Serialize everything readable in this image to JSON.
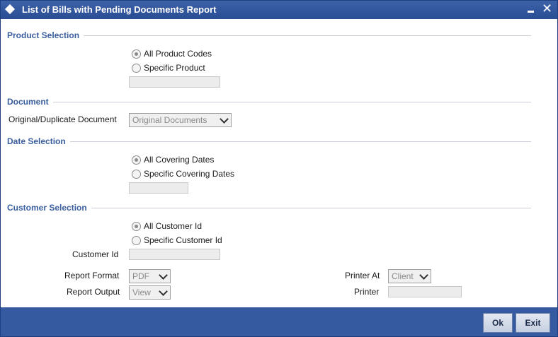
{
  "window": {
    "title": "List of Bills with Pending Documents Report",
    "minimize_symbol": "",
    "close_symbol": "✕"
  },
  "product_selection": {
    "heading": "Product Selection",
    "options": [
      "All Product Codes",
      "Specific Product"
    ],
    "selected_index": 0,
    "product_field_value": ""
  },
  "document": {
    "heading": "Document",
    "label": "Original/Duplicate Document",
    "selected": "Original Documents"
  },
  "date_selection": {
    "heading": "Date Selection",
    "options": [
      "All Covering Dates",
      "Specific Covering Dates"
    ],
    "selected_index": 0,
    "date_field_value": ""
  },
  "customer_selection": {
    "heading": "Customer Selection",
    "options": [
      "All Customer Id",
      "Specific Customer Id"
    ],
    "selected_index": 0,
    "customer_id_label": "Customer Id",
    "customer_id_value": ""
  },
  "report": {
    "format_label": "Report Format",
    "format_value": "PDF",
    "output_label": "Report Output",
    "output_value": "View",
    "printer_at_label": "Printer At",
    "printer_at_value": "Client",
    "printer_label": "Printer",
    "printer_value": ""
  },
  "footer": {
    "ok_label": "Ok",
    "exit_label": "Exit"
  },
  "colors": {
    "titlebar": "#2a4d94",
    "footer": "#355aa0",
    "section_heading": "#3a5e9e"
  }
}
